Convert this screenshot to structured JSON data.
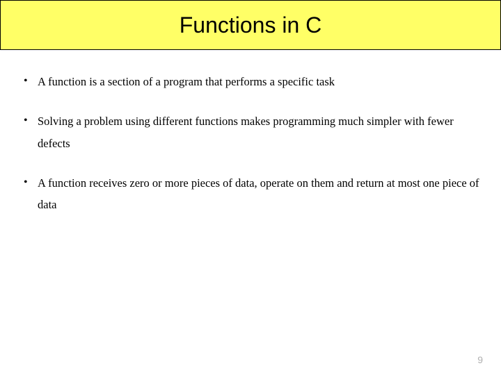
{
  "title": "Functions in C",
  "bullets": [
    "A function is a section of a program that performs a specific task",
    "Solving a problem using different functions makes programming much simpler with fewer defects",
    "A function receives zero or more pieces of data, operate on them and return at most one piece of data"
  ],
  "page_number": "9"
}
